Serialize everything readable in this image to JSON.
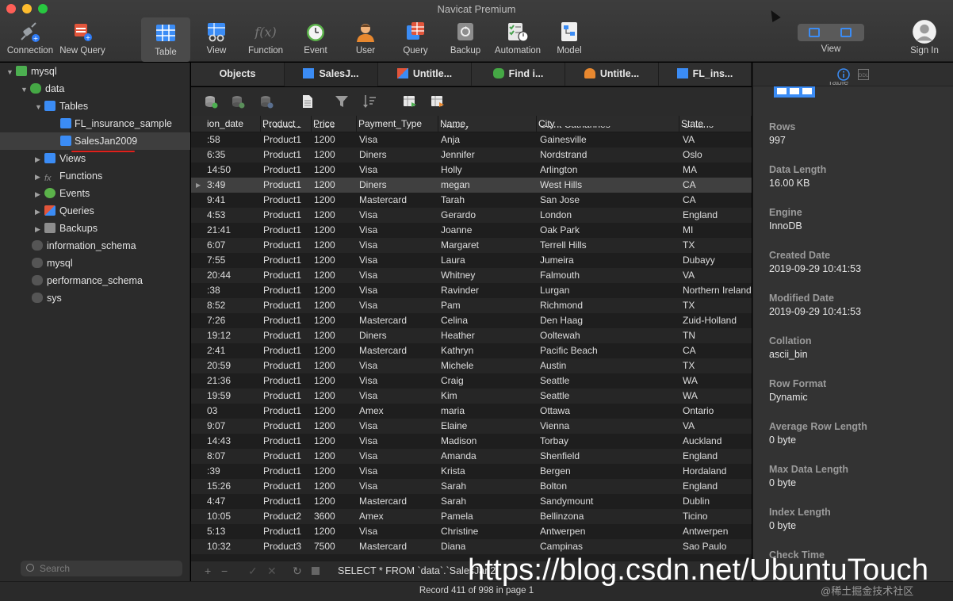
{
  "app": {
    "title": "Navicat Premium",
    "colors": {
      "accent": "#3b8cf5",
      "selection_underline": "#e0201b"
    }
  },
  "toolbar": {
    "items": [
      {
        "label": "Connection",
        "icon": "connection-icon"
      },
      {
        "label": "New Query",
        "icon": "new-query-icon"
      },
      {
        "label": "Table",
        "icon": "table-icon"
      },
      {
        "label": "View",
        "icon": "view-icon"
      },
      {
        "label": "Function",
        "icon": "function-icon"
      },
      {
        "label": "Event",
        "icon": "clock-icon"
      },
      {
        "label": "User",
        "icon": "user-icon"
      },
      {
        "label": "Query",
        "icon": "query-icon"
      },
      {
        "label": "Backup",
        "icon": "backup-icon"
      },
      {
        "label": "Automation",
        "icon": "automation-icon"
      },
      {
        "label": "Model",
        "icon": "model-icon"
      }
    ],
    "view_label": "View",
    "signin_label": "Sign In"
  },
  "sidebar": {
    "tree": [
      {
        "label": "mysql",
        "icon": "connection-icon"
      },
      {
        "label": "data",
        "icon": "database-icon"
      },
      {
        "label": "Tables",
        "icon": "tables-icon"
      },
      {
        "label": "FL_insurance_sample",
        "icon": "table-icon"
      },
      {
        "label": "SalesJan2009",
        "icon": "table-icon"
      },
      {
        "label": "Views",
        "icon": "views-icon"
      },
      {
        "label": "Functions",
        "icon": "function-icon"
      },
      {
        "label": "Events",
        "icon": "clock-icon"
      },
      {
        "label": "Queries",
        "icon": "query-icon"
      },
      {
        "label": "Backups",
        "icon": "backup-icon"
      },
      {
        "label": "information_schema",
        "icon": "database-icon"
      },
      {
        "label": "mysql",
        "icon": "database-icon"
      },
      {
        "label": "performance_schema",
        "icon": "database-icon"
      },
      {
        "label": "sys",
        "icon": "database-icon"
      }
    ],
    "search_placeholder": "Search"
  },
  "tabs": [
    {
      "label": "Objects"
    },
    {
      "label": "SalesJ...",
      "icon": "table-icon"
    },
    {
      "label": "Untitle...",
      "icon": "query-icon"
    },
    {
      "label": "Find i...",
      "icon": "database-icon"
    },
    {
      "label": "Untitle...",
      "icon": "user-icon"
    },
    {
      "label": "FL_ins...",
      "icon": "table-icon"
    }
  ],
  "grid": {
    "columns": [
      "ion_date",
      "Product",
      "Price",
      "Payment_Type",
      "Name",
      "City",
      "State"
    ],
    "partial_row": [
      "",
      "Product1",
      "1200",
      "",
      "Tracey",
      "Saint Catharines",
      "Ontario"
    ],
    "rows": [
      [
        ":58",
        "Product1",
        "1200",
        "Visa",
        "Anja",
        "Gainesville",
        "VA"
      ],
      [
        "6:35",
        "Product1",
        "1200",
        "Diners",
        "Jennifer",
        "Nordstrand",
        "Oslo"
      ],
      [
        "14:50",
        "Product1",
        "1200",
        "Visa",
        "Holly",
        "Arlington",
        "MA"
      ],
      [
        "3:49",
        "Product1",
        "1200",
        "Diners",
        "megan",
        "West Hills",
        "CA"
      ],
      [
        "9:41",
        "Product1",
        "1200",
        "Mastercard",
        "Tarah",
        "San Jose",
        "CA"
      ],
      [
        "4:53",
        "Product1",
        "1200",
        "Visa",
        "Gerardo",
        "London",
        "England"
      ],
      [
        "21:41",
        "Product1",
        "1200",
        "Visa",
        "Joanne",
        "Oak Park",
        "MI"
      ],
      [
        "6:07",
        "Product1",
        "1200",
        "Visa",
        "Margaret",
        "Terrell Hills",
        "TX"
      ],
      [
        "7:55",
        "Product1",
        "1200",
        "Visa",
        "Laura",
        "Jumeira",
        "Dubayy"
      ],
      [
        "20:44",
        "Product1",
        "1200",
        "Visa",
        "Whitney",
        "Falmouth",
        "VA"
      ],
      [
        ":38",
        "Product1",
        "1200",
        "Visa",
        "Ravinder",
        "Lurgan",
        "Northern Ireland"
      ],
      [
        "8:52",
        "Product1",
        "1200",
        "Visa",
        "Pam",
        "Richmond",
        "TX"
      ],
      [
        "7:26",
        "Product1",
        "1200",
        "Mastercard",
        "Celina",
        "Den Haag",
        "Zuid-Holland"
      ],
      [
        "19:12",
        "Product1",
        "1200",
        "Diners",
        "Heather",
        "Ooltewah",
        "TN"
      ],
      [
        "2:41",
        "Product1",
        "1200",
        "Mastercard",
        "Kathryn",
        "Pacific Beach",
        "CA"
      ],
      [
        "20:59",
        "Product1",
        "1200",
        "Visa",
        "Michele",
        "Austin",
        "TX"
      ],
      [
        "21:36",
        "Product1",
        "1200",
        "Visa",
        "Craig",
        "Seattle",
        "WA"
      ],
      [
        "19:59",
        "Product1",
        "1200",
        "Visa",
        "Kim",
        "Seattle",
        "WA"
      ],
      [
        "03",
        "Product1",
        "1200",
        "Amex",
        "maria",
        "Ottawa",
        "Ontario"
      ],
      [
        "9:07",
        "Product1",
        "1200",
        "Visa",
        "Elaine",
        "Vienna",
        "VA"
      ],
      [
        "14:43",
        "Product1",
        "1200",
        "Visa",
        "Madison",
        "Torbay",
        "Auckland"
      ],
      [
        "8:07",
        "Product1",
        "1200",
        "Visa",
        "Amanda",
        "Shenfield",
        "England"
      ],
      [
        ":39",
        "Product1",
        "1200",
        "Visa",
        "Krista",
        "Bergen",
        "Hordaland"
      ],
      [
        "15:26",
        "Product1",
        "1200",
        "Visa",
        "Sarah",
        "Bolton",
        "England"
      ],
      [
        "4:47",
        "Product1",
        "1200",
        "Mastercard",
        "Sarah",
        "Sandymount",
        "Dublin"
      ],
      [
        "10:05",
        "Product2",
        "3600",
        "Amex",
        "Pamela",
        "Bellinzona",
        "Ticino"
      ],
      [
        "5:13",
        "Product1",
        "1200",
        "Visa",
        "Christine",
        "Antwerpen",
        "Antwerpen"
      ],
      [
        "10:32",
        "Product3",
        "7500",
        "Mastercard",
        "Diana",
        "Campinas",
        "Sao Paulo"
      ]
    ]
  },
  "bottom": {
    "sql": "SELECT * FROM `data`.`SalesJan2",
    "status": "Record 411 of 998 in page 1"
  },
  "info": {
    "partial_label": "Table",
    "items": [
      {
        "label": "Rows",
        "value": "997"
      },
      {
        "label": "Data Length",
        "value": "16.00 KB"
      },
      {
        "label": "Engine",
        "value": "InnoDB"
      },
      {
        "label": "Created Date",
        "value": "2019-09-29 10:41:53"
      },
      {
        "label": "Modified Date",
        "value": "2019-09-29 10:41:53"
      },
      {
        "label": "Collation",
        "value": "ascii_bin"
      },
      {
        "label": "Row Format",
        "value": "Dynamic"
      },
      {
        "label": "Average Row Length",
        "value": "0 byte"
      },
      {
        "label": "Max Data Length",
        "value": "0 byte"
      },
      {
        "label": "Index Length",
        "value": "0 byte"
      },
      {
        "label": "Check Time",
        "value": ""
      }
    ]
  },
  "watermark": {
    "url": "https://blog.csdn.net/UbuntuTouch",
    "site": "@稀土掘金技术社区"
  }
}
